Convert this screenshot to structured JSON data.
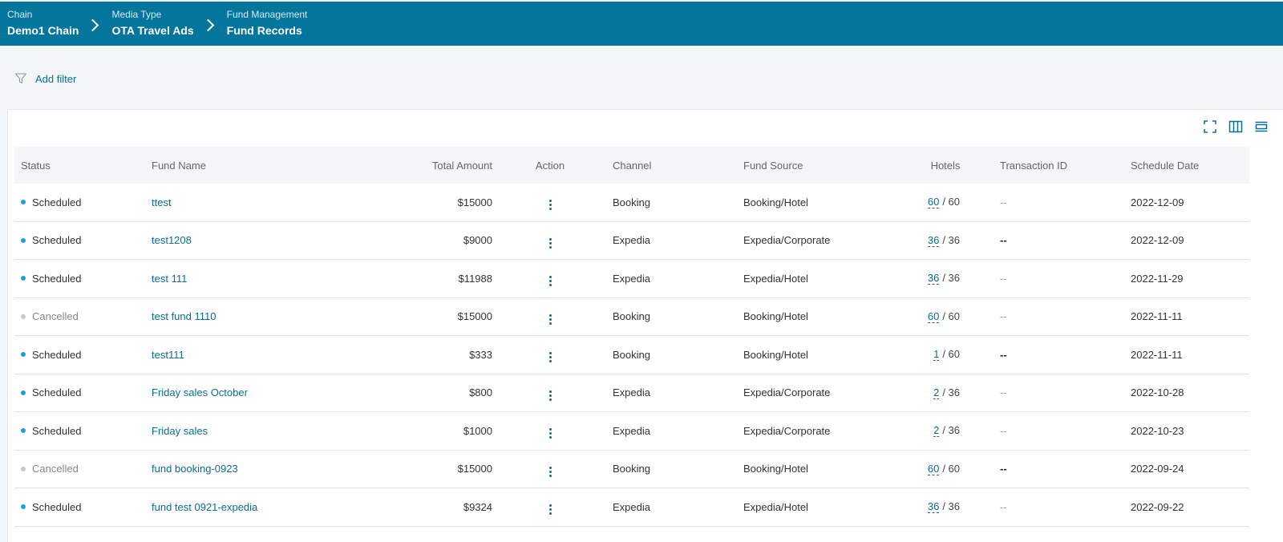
{
  "breadcrumb": [
    {
      "small": "Chain",
      "big": "Demo1 Chain"
    },
    {
      "small": "Media Type",
      "big": "OTA Travel Ads"
    },
    {
      "small": "Fund Management",
      "big": "Fund Records"
    }
  ],
  "filter": {
    "label": "Add filter"
  },
  "colors": {
    "header": "#04759c",
    "link": "#0a6d93",
    "scheduled_dot": "#1aa3d8",
    "cancelled_dot": "#c9c9c9"
  },
  "toolbar_icons": [
    "fullscreen-icon",
    "columns-icon",
    "density-icon"
  ],
  "table": {
    "headers": {
      "status": "Status",
      "name": "Fund Name",
      "amount": "Total Amount",
      "action": "Action",
      "channel": "Channel",
      "source": "Fund Source",
      "hotels": "Hotels",
      "txn": "Transaction ID",
      "date": "Schedule Date"
    },
    "rows": [
      {
        "status": "Scheduled",
        "name": "ttest",
        "amount": "$15000",
        "channel": "Booking",
        "source": "Booking/Hotel",
        "hotels_count": "60",
        "hotels_total": "/ 60",
        "txn": "--",
        "txn_bold": false,
        "date": "2022-12-09"
      },
      {
        "status": "Scheduled",
        "name": "test1208",
        "amount": "$9000",
        "channel": "Expedia",
        "source": "Expedia/Corporate",
        "hotels_count": "36",
        "hotels_total": "/ 36",
        "txn": "--",
        "txn_bold": true,
        "date": "2022-12-09"
      },
      {
        "status": "Scheduled",
        "name": "test 111",
        "amount": "$11988",
        "channel": "Expedia",
        "source": "Expedia/Hotel",
        "hotels_count": "36",
        "hotels_total": "/ 36",
        "txn": "--",
        "txn_bold": false,
        "date": "2022-11-29"
      },
      {
        "status": "Cancelled",
        "name": "test fund 1110",
        "amount": "$15000",
        "channel": "Booking",
        "source": "Booking/Hotel",
        "hotels_count": "60",
        "hotels_total": "/ 60",
        "txn": "--",
        "txn_bold": false,
        "date": "2022-11-11"
      },
      {
        "status": "Scheduled",
        "name": "test111",
        "amount": "$333",
        "channel": "Booking",
        "source": "Booking/Hotel",
        "hotels_count": "1",
        "hotels_total": "/ 60",
        "txn": "--",
        "txn_bold": true,
        "date": "2022-11-11"
      },
      {
        "status": "Scheduled",
        "name": "Friday sales October",
        "amount": "$800",
        "channel": "Expedia",
        "source": "Expedia/Corporate",
        "hotels_count": "2",
        "hotels_total": "/ 36",
        "txn": "--",
        "txn_bold": false,
        "date": "2022-10-28"
      },
      {
        "status": "Scheduled",
        "name": "Friday sales",
        "amount": "$1000",
        "channel": "Expedia",
        "source": "Expedia/Corporate",
        "hotels_count": "2",
        "hotels_total": "/ 36",
        "txn": "--",
        "txn_bold": false,
        "date": "2022-10-23"
      },
      {
        "status": "Cancelled",
        "name": "fund booking-0923",
        "amount": "$15000",
        "channel": "Booking",
        "source": "Booking/Hotel",
        "hotels_count": "60",
        "hotels_total": "/ 60",
        "txn": "--",
        "txn_bold": true,
        "date": "2022-09-24"
      },
      {
        "status": "Scheduled",
        "name": "fund test 0921-expedia",
        "amount": "$9324",
        "channel": "Expedia",
        "source": "Expedia/Hotel",
        "hotels_count": "36",
        "hotels_total": "/ 36",
        "txn": "--",
        "txn_bold": false,
        "date": "2022-09-22"
      }
    ]
  }
}
